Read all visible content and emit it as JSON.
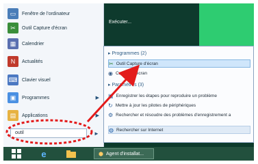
{
  "desktop": {
    "label": "Exécuter..."
  },
  "start_menu": {
    "items": [
      {
        "label": "Fenêtre de l'ordinateur",
        "icon": "window-icon",
        "color": "#4a7db8"
      },
      {
        "label": "Outil Capture d'écran",
        "icon": "scissors-icon",
        "color": "#3a8e3a"
      },
      {
        "label": "Calendrier",
        "icon": "calendar-icon",
        "color": "#5a6fb0"
      },
      {
        "label": "Actualités",
        "icon": "news-icon",
        "color": "#c0392b"
      },
      {
        "label": "Clavier visuel",
        "icon": "keyboard-icon",
        "color": "#4b78c2"
      },
      {
        "label": "Programmes",
        "icon": "folder-icon",
        "color": "#4a90e2"
      },
      {
        "label": "Applications",
        "icon": "apps-icon",
        "color": "#e7b241"
      }
    ],
    "search": {
      "value": "outil",
      "arrow": "►"
    }
  },
  "results_panel": {
    "sections": [
      {
        "title": "▸ Programmes (2)",
        "items": [
          {
            "label": "Outil Capture d'écran",
            "highlight": "primary",
            "icon": "scissors-icon"
          },
          {
            "label": "Capture d'écran",
            "highlight": "none",
            "icon": "camera-icon"
          }
        ]
      },
      {
        "title": "▸ Paramètres (3)",
        "items": [
          {
            "label": "Enregistrer les étapes pour reproduire un problème",
            "highlight": "none",
            "icon": "record-icon"
          },
          {
            "label": "Mettre à jour les pilotes de périphériques",
            "highlight": "none",
            "icon": "update-icon"
          },
          {
            "label": "Rechercher et résoudre des problèmes d'enregistrement a",
            "highlight": "none",
            "icon": "troubleshoot-icon"
          }
        ]
      }
    ],
    "footer": {
      "label": "Rechercher sur Internet",
      "highlight": "secondary",
      "icon": "globe-icon"
    }
  },
  "taskbar": {
    "windows_icon": "windows-logo-icon",
    "ie_icon": "ie-icon",
    "explorer_icon": "folder-icon",
    "active_label": "Agent d'installat..."
  },
  "annotation": {
    "color": "#e31b1b"
  }
}
